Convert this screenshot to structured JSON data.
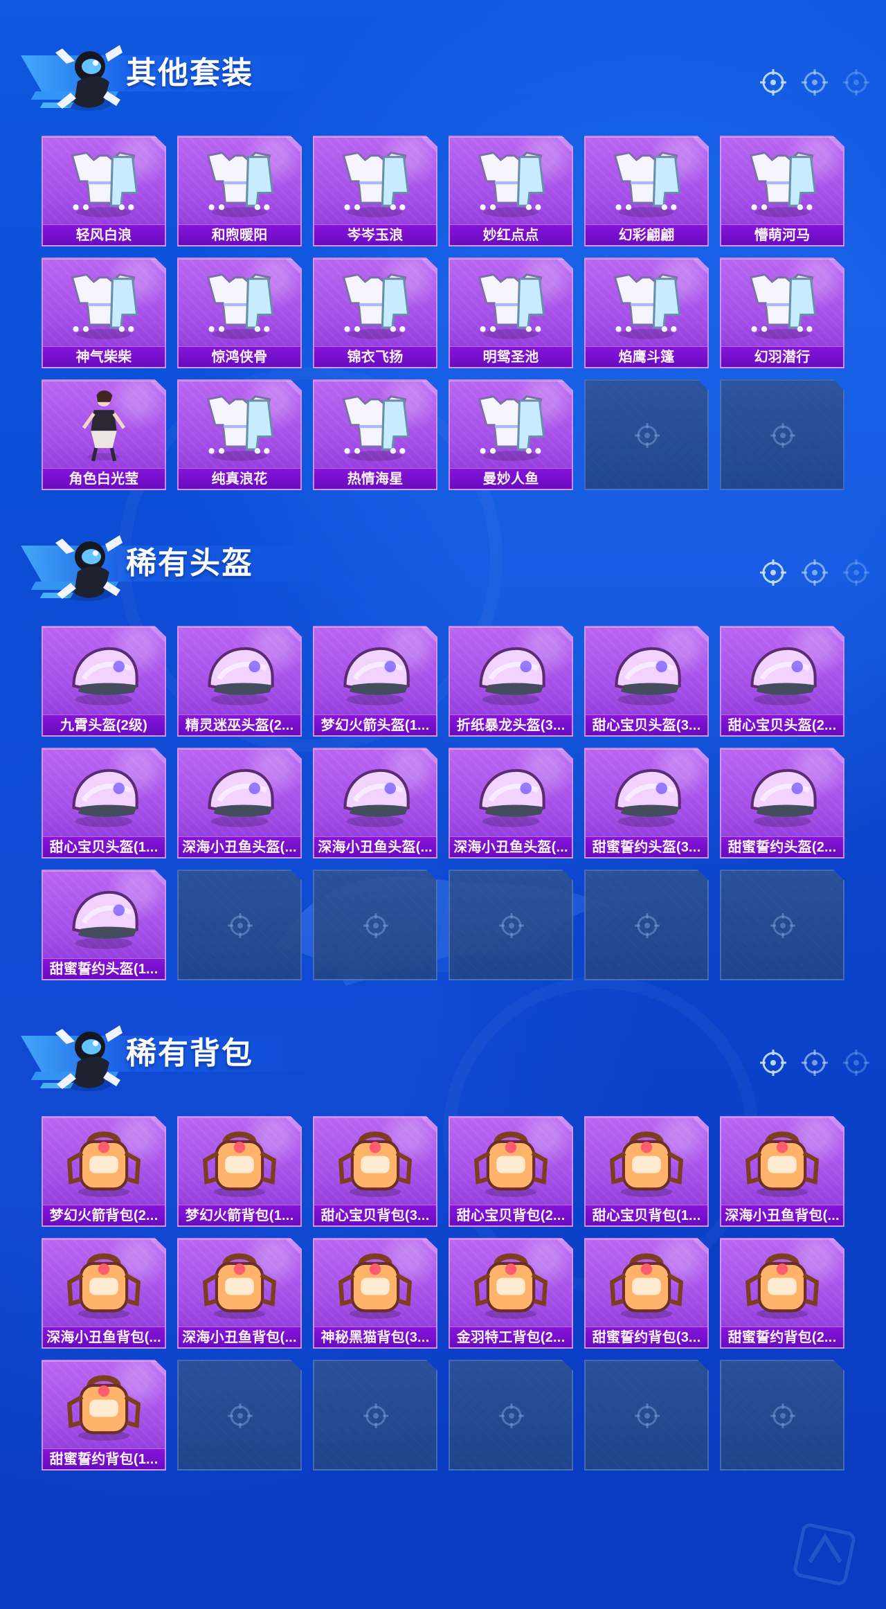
{
  "colors": {
    "page_background": "#0d4fd8",
    "card_purple": "#a44fe8",
    "card_label": "#6e0ac0",
    "empty_slot": "#274a89"
  },
  "sections": [
    {
      "title": "其他套装",
      "items": [
        {
          "label": "轻风白浪",
          "icon": "outfit-icon"
        },
        {
          "label": "和煦暖阳",
          "icon": "outfit-icon"
        },
        {
          "label": "岑岑玉浪",
          "icon": "outfit-icon"
        },
        {
          "label": "妙红点点",
          "icon": "outfit-icon"
        },
        {
          "label": "幻彩翩翩",
          "icon": "outfit-icon"
        },
        {
          "label": "懵萌河马",
          "icon": "outfit-icon"
        },
        {
          "label": "神气柴柴",
          "icon": "outfit-icon"
        },
        {
          "label": "惊鸿侠骨",
          "icon": "outfit-icon"
        },
        {
          "label": "锦衣飞扬",
          "icon": "outfit-icon"
        },
        {
          "label": "明鸳圣池",
          "icon": "outfit-icon"
        },
        {
          "label": "焰鹰斗篷",
          "icon": "outfit-icon"
        },
        {
          "label": "幻羽潜行",
          "icon": "outfit-icon"
        },
        {
          "label": "角色白光莹",
          "icon": "character-icon"
        },
        {
          "label": "纯真浪花",
          "icon": "outfit-icon"
        },
        {
          "label": "热情海星",
          "icon": "outfit-icon"
        },
        {
          "label": "曼妙人鱼",
          "icon": "outfit-icon"
        }
      ],
      "empty_slots": 2
    },
    {
      "title": "稀有头盔",
      "items": [
        {
          "label": "九霄头盔(2级)",
          "icon": "helmet-icon"
        },
        {
          "label": "精灵迷巫头盔(2...",
          "icon": "helmet-icon"
        },
        {
          "label": "梦幻火箭头盔(1...",
          "icon": "helmet-icon"
        },
        {
          "label": "折纸暴龙头盔(3...",
          "icon": "helmet-icon"
        },
        {
          "label": "甜心宝贝头盔(3...",
          "icon": "helmet-icon"
        },
        {
          "label": "甜心宝贝头盔(2...",
          "icon": "helmet-icon"
        },
        {
          "label": "甜心宝贝头盔(1...",
          "icon": "helmet-icon"
        },
        {
          "label": "深海小丑鱼头盔(...",
          "icon": "helmet-icon"
        },
        {
          "label": "深海小丑鱼头盔(...",
          "icon": "helmet-icon"
        },
        {
          "label": "深海小丑鱼头盔(...",
          "icon": "helmet-icon"
        },
        {
          "label": "甜蜜誓约头盔(3...",
          "icon": "helmet-icon"
        },
        {
          "label": "甜蜜誓约头盔(2...",
          "icon": "helmet-icon"
        },
        {
          "label": "甜蜜誓约头盔(1...",
          "icon": "helmet-icon"
        }
      ],
      "empty_slots": 5
    },
    {
      "title": "稀有背包",
      "items": [
        {
          "label": "梦幻火箭背包(2...",
          "icon": "backpack-icon"
        },
        {
          "label": "梦幻火箭背包(1...",
          "icon": "backpack-icon"
        },
        {
          "label": "甜心宝贝背包(3...",
          "icon": "backpack-icon"
        },
        {
          "label": "甜心宝贝背包(2...",
          "icon": "backpack-icon"
        },
        {
          "label": "甜心宝贝背包(1...",
          "icon": "backpack-icon"
        },
        {
          "label": "深海小丑鱼背包(...",
          "icon": "backpack-icon"
        },
        {
          "label": "深海小丑鱼背包(...",
          "icon": "backpack-icon"
        },
        {
          "label": "深海小丑鱼背包(...",
          "icon": "backpack-icon"
        },
        {
          "label": "神秘黑猫背包(3...",
          "icon": "backpack-icon"
        },
        {
          "label": "金羽特工背包(2...",
          "icon": "backpack-icon"
        },
        {
          "label": "甜蜜誓约背包(3...",
          "icon": "backpack-icon"
        },
        {
          "label": "甜蜜誓约背包(2...",
          "icon": "backpack-icon"
        },
        {
          "label": "甜蜜誓约背包(1...",
          "icon": "backpack-icon"
        }
      ],
      "empty_slots": 5
    }
  ]
}
